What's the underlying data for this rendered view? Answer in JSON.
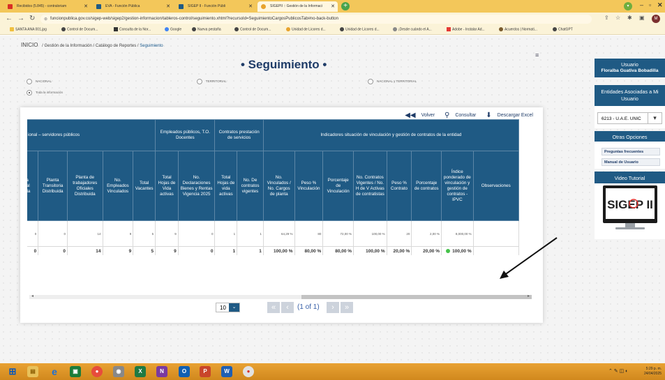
{
  "browser": {
    "tabs": [
      {
        "label": "Recibidos (5.845) - contraloriam",
        "color": "#d93025"
      },
      {
        "label": "EVA - Función Pública",
        "color": "#1f5a84"
      },
      {
        "label": "SIGEP II - Función Públi",
        "color": "#1f5a84"
      },
      {
        "label": "SIGEPII :: Gestión de la Informaci",
        "color": "#e8a32d"
      }
    ],
    "new_tab": "+",
    "url": "funcionpublica.gov.co/sigep-web/sigep2/gestion-informacion/tableros-control/seguimiento.xhtml?recursoId=SeguimientoCargosPublicosTab#no-back-button",
    "profile_initial": "M",
    "bookmarks": [
      "SANTA ANA 001.jpg",
      "Control de Docum...",
      "Consulta de la Nor...",
      "Google",
      "Nueva pestaña",
      "Control de Docum...",
      "Unidad de Licores d...",
      "Unidad de Licores d...",
      "¡Desde cuándo el A...",
      "Adobe - Instalar Ad...",
      "Acuerdos | Normati...",
      "ChatGPT"
    ]
  },
  "breadcrumb": {
    "home": "INICIO",
    "items": [
      "Gestión de la Información",
      "Catálogo de Reportes"
    ],
    "current": "Seguimiento",
    "sep": "/"
  },
  "page_title": "• Seguimiento •",
  "filters": {
    "nacional": "NACIONAL",
    "territorial": "TERRITORIAL",
    "nacional_territorial": "NACIONAL y TERRITORIAL",
    "toda": "Toda la información"
  },
  "toolbar": {
    "volver": "Volver",
    "consultar": "Consultar",
    "descargar": "Descargar Excel"
  },
  "table": {
    "group_headers": [
      "ional – servidores públicos",
      "Empleados públicos, T.O. Docentes",
      "Contratos prestación de servicios",
      "Indicadores situación de vinculación y gestión de contratos de la entidad"
    ],
    "columns": [
      "a\nral\nida",
      "Planta Transitoria Distribuida",
      "Planta de trabajadores Oficiales Distribuida",
      "No. Empleados Vinculados",
      "Total Vacantes",
      "Total Hojas de Vida activas",
      "No. Declaraciones Bienes y Rentas Vigencia 2025",
      "Total Hojas de vida activas",
      "No. De contratos vigentes",
      "No. Vinculados / No. Cargos de planta",
      "Peso % Vinculación",
      "Porcentaje de Vinculación",
      "No. Contratos Vigentes / No. H de V Activas de contratistas",
      "Peso % Contrato",
      "Porcentaje de contratos",
      "Índice ponderado de vinculación y gestión de contratos - IPVC",
      "Observaciones"
    ],
    "row1": [
      "0",
      "0",
      "14",
      "9",
      "5",
      "9",
      "0",
      "1",
      "1",
      "64,29 %",
      "80",
      "72,00 %",
      "100,00 %",
      "20",
      "2,00 %",
      "8,000,00 %",
      ""
    ],
    "row2": [
      "0",
      "0",
      "14",
      "9",
      "5",
      "9",
      "0",
      "1",
      "1",
      "100,00 %",
      "80,00 %",
      "80,00 %",
      "100,00 %",
      "20,00 %",
      "20,00 %",
      "100,00 %",
      ""
    ]
  },
  "pager": {
    "page_size": "10",
    "info": "(1 of 1)"
  },
  "right_panel": {
    "usuario_title": "Usuario",
    "usuario_name": "Floralba Guativa Bobadilla",
    "entidades_title": "Entidades Asociadas a Mi Usuario",
    "entidad_selected": "6213 - U.A.E. UNIC",
    "otras_title": "Otras Opciones",
    "links": [
      "Preguntas frecuentes",
      "Manual de Usuario"
    ],
    "video_title": "Video Tutorial",
    "logo_text": "SIGEP II"
  },
  "taskbar": {
    "time": "5:29 p. m.",
    "date": "24/04/2025"
  }
}
